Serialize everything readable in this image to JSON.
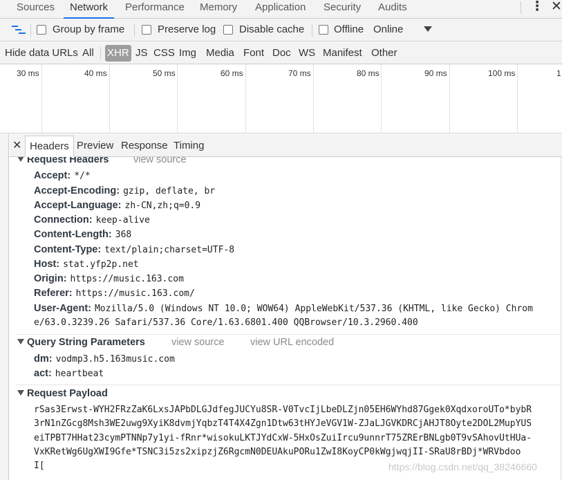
{
  "main_tabs": [
    "Sources",
    "Network",
    "Performance",
    "Memory",
    "Application",
    "Security",
    "Audits"
  ],
  "toolbar": {
    "group_by_frame": "Group by frame",
    "preserve_log": "Preserve log",
    "disable_cache": "Disable cache",
    "offline": "Offline",
    "throttle": "Online"
  },
  "filters": {
    "hide_data_urls": "Hide data URLs",
    "types": [
      "All",
      "XHR",
      "JS",
      "CSS",
      "Img",
      "Media",
      "Font",
      "Doc",
      "WS",
      "Manifest",
      "Other"
    ]
  },
  "timeline_ticks": [
    "30 ms",
    "40 ms",
    "50 ms",
    "60 ms",
    "70 ms",
    "80 ms",
    "90 ms",
    "100 ms",
    "1"
  ],
  "detail_tabs": [
    "Headers",
    "Preview",
    "Response",
    "Timing"
  ],
  "request_headers": {
    "title": "Request Headers",
    "view_source": "view source",
    "items": [
      {
        "name": "Accept:",
        "value": "*/*"
      },
      {
        "name": "Accept-Encoding:",
        "value": "gzip, deflate, br"
      },
      {
        "name": "Accept-Language:",
        "value": "zh-CN,zh;q=0.9"
      },
      {
        "name": "Connection:",
        "value": "keep-alive"
      },
      {
        "name": "Content-Length:",
        "value": "368"
      },
      {
        "name": "Content-Type:",
        "value": "text/plain;charset=UTF-8"
      },
      {
        "name": "Host:",
        "value": "stat.yfp2p.net"
      },
      {
        "name": "Origin:",
        "value": "https://music.163.com"
      },
      {
        "name": "Referer:",
        "value": "https://music.163.com/"
      },
      {
        "name": "User-Agent:",
        "value": "Mozilla/5.0 (Windows NT 10.0; WOW64) AppleWebKit/537.36 (KHTML, like Gecko) Chrom"
      }
    ],
    "user_agent_cont": "e/63.0.3239.26 Safari/537.36 Core/1.63.6801.400 QQBrowser/10.3.2960.400"
  },
  "query_params": {
    "title": "Query String Parameters",
    "view_source": "view source",
    "view_url_encoded": "view URL encoded",
    "items": [
      {
        "name": "dm:",
        "value": "vodmp3.h5.163music.com"
      },
      {
        "name": "act:",
        "value": "heartbeat"
      }
    ]
  },
  "payload": {
    "title": "Request Payload",
    "lines": [
      "rSas3Erwst-WYH2FRzZaK6LxsJAPbDLGJdfegJUCYu8SR-V0TvcIjLbeDLZjn05EH6WYhd87Ggek0XqdxoroUTo*bybR",
      "3rN1nZGcg8Msh3WE2uwg9XyiK8dvmjYqbzT4T4X4Zgn1Dtw63tHYJeVGV1W-ZJaLJGVKDRCjAHJT8Oyte2DOL2MupYUS",
      "eiTPBT7HHat23cymPTNNp7y1yi-fRnr*wisokuLKTJYdCxW-5HxOsZuiIrcu9unnrT75ZRErBNLgb0T9vSAhovUtHUa-",
      "VxKRetWg6UgXWI9Gfe*TSNC3i5zs2xipzjZ6RgcmN0DEUAkuPORu1ZwI8KoyCP0kWgjwqjII-SRaU8rBDj*WRVbdoo",
      "I["
    ]
  },
  "watermark": "https://blog.csdn.net/qq_38246660"
}
